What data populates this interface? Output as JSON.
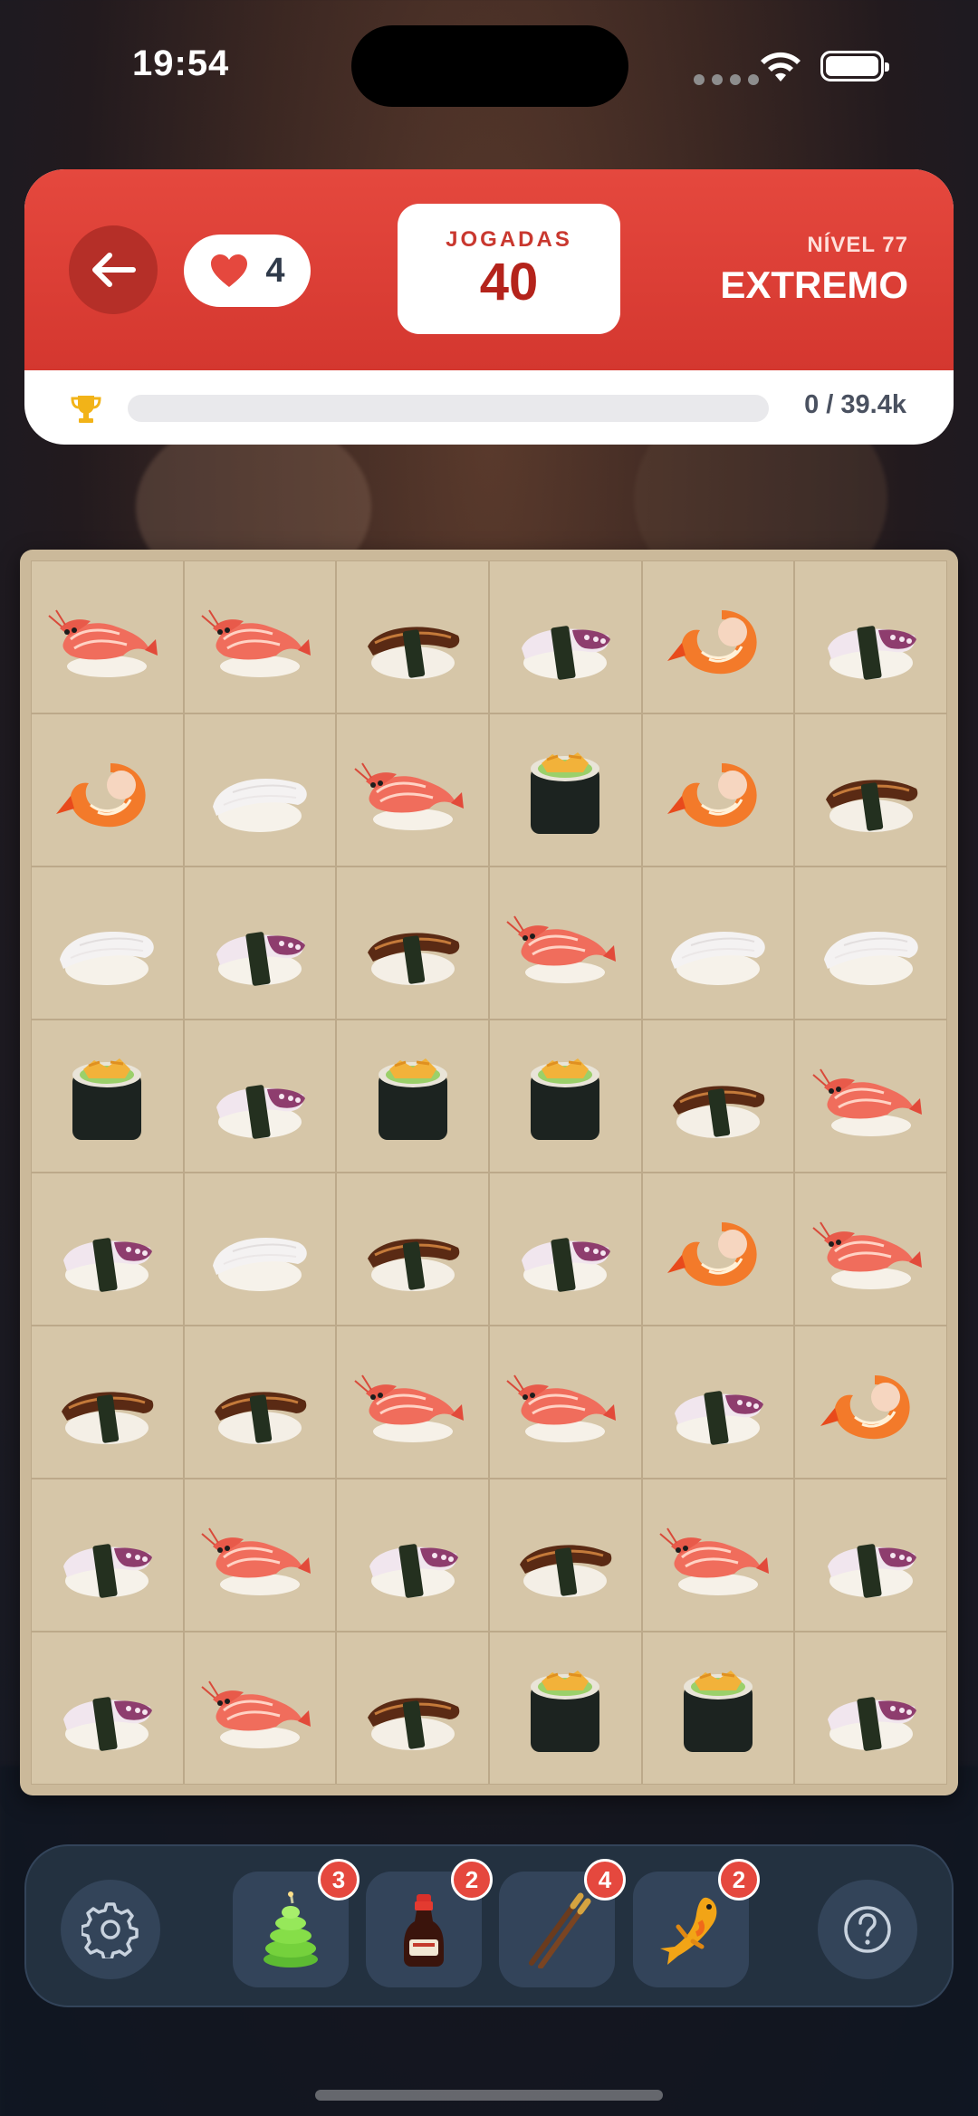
{
  "status_bar": {
    "time": "19:54"
  },
  "header": {
    "lives": "4",
    "moves_label": "JOGADAS",
    "moves_value": "40",
    "level_number": "NÍVEL 77",
    "level_name": "EXTREMO",
    "score_text": "0 / 39.4k",
    "score_progress": 0
  },
  "colors": {
    "header_red": "#e5483e",
    "board_tan": "#d6c6a8",
    "toolbar_navy": "#233140"
  },
  "board": {
    "columns": 6,
    "rows": [
      [
        "shrimp-nigiri",
        "shrimp-nigiri",
        "eel-nigiri",
        "octopus-nigiri",
        "cooked-shrimp",
        "octopus-nigiri"
      ],
      [
        "cooked-shrimp",
        "squid-nigiri",
        "shrimp-nigiri",
        "tamago-maki",
        "cooked-shrimp",
        "eel-nigiri"
      ],
      [
        "squid-nigiri",
        "octopus-nigiri",
        "eel-nigiri",
        "shrimp-nigiri",
        "squid-nigiri",
        "squid-nigiri"
      ],
      [
        "tamago-maki",
        "octopus-nigiri",
        "tamago-maki",
        "tamago-maki",
        "eel-nigiri",
        "shrimp-nigiri"
      ],
      [
        "octopus-nigiri",
        "squid-nigiri",
        "eel-nigiri",
        "octopus-nigiri",
        "cooked-shrimp",
        "shrimp-nigiri"
      ],
      [
        "eel-nigiri",
        "eel-nigiri",
        "shrimp-nigiri",
        "shrimp-nigiri",
        "octopus-nigiri",
        "cooked-shrimp"
      ],
      [
        "octopus-nigiri",
        "shrimp-nigiri",
        "octopus-nigiri",
        "eel-nigiri",
        "shrimp-nigiri",
        "octopus-nigiri"
      ],
      [
        "octopus-nigiri",
        "shrimp-nigiri",
        "eel-nigiri",
        "tamago-maki",
        "tamago-maki",
        "octopus-nigiri"
      ]
    ]
  },
  "toolbar": {
    "powerups": [
      {
        "icon": "wasabi-bomb-icon",
        "count": "3"
      },
      {
        "icon": "soy-sauce-icon",
        "count": "2"
      },
      {
        "icon": "chopsticks-icon",
        "count": "4"
      },
      {
        "icon": "koi-fish-icon",
        "count": "2"
      }
    ]
  }
}
